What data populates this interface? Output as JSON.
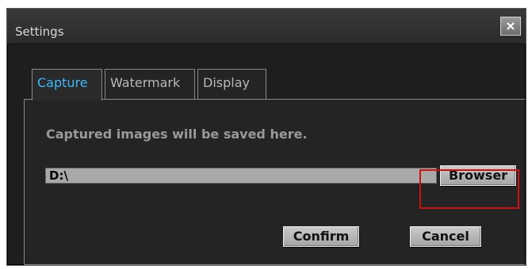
{
  "window": {
    "title": "Settings"
  },
  "tabs": [
    {
      "label": "Capture",
      "active": true
    },
    {
      "label": "Watermark",
      "active": false
    },
    {
      "label": "Display",
      "active": false
    }
  ],
  "capture": {
    "info_text": "Captured images will be saved here.",
    "path_value": "D:\\",
    "browser_label": "Browser",
    "confirm_label": "Confirm",
    "cancel_label": "Cancel"
  },
  "colors": {
    "window_bg": "#1e1e1e",
    "active_tab": "#3eb9ff",
    "highlight": "#cc1111"
  },
  "icons": {
    "close": "close-icon"
  }
}
